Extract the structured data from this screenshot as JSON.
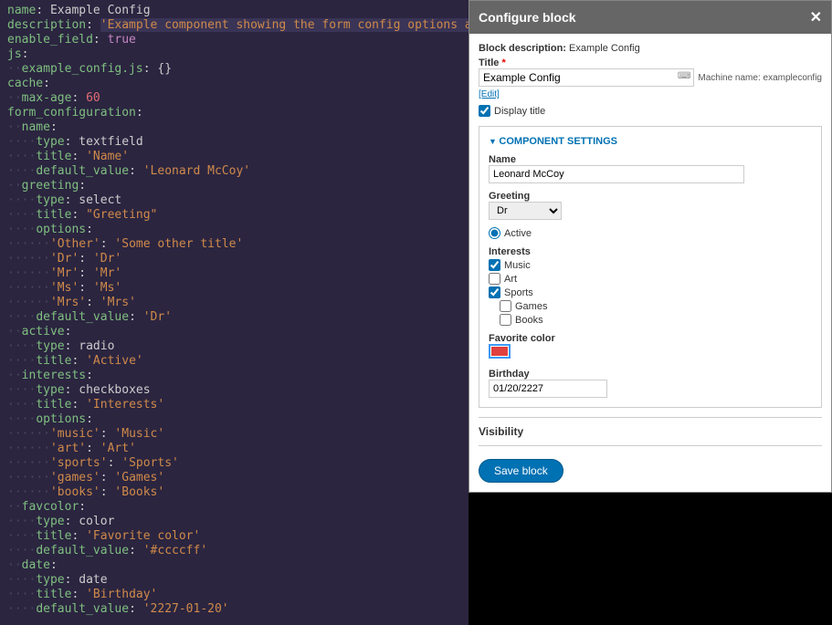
{
  "code": {
    "name": "Example Config",
    "description": "'Example component showing the form config options available'",
    "enable_field": "true",
    "js_key": "js",
    "js_file": "example_config.js",
    "cache_key": "cache",
    "max_age": "60",
    "form_cfg": "form_configuration",
    "name_block": {
      "type": "textfield",
      "title": "'Name'",
      "default": "'Leonard McCoy'"
    },
    "greeting_block": {
      "type": "select",
      "title": "\"Greeting\"",
      "opts": [
        [
          "'Other'",
          "'Some other title'"
        ],
        [
          "'Dr'",
          "'Dr'"
        ],
        [
          "'Mr'",
          "'Mr'"
        ],
        [
          "'Ms'",
          "'Ms'"
        ],
        [
          "'Mrs'",
          "'Mrs'"
        ]
      ],
      "default": "'Dr'"
    },
    "active_block": {
      "type": "radio",
      "title": "'Active'"
    },
    "interests_block": {
      "type": "checkboxes",
      "title": "'Interests'",
      "opts": [
        [
          "'music'",
          "'Music'"
        ],
        [
          "'art'",
          "'Art'"
        ],
        [
          "'sports'",
          "'Sports'"
        ],
        [
          "'games'",
          "'Games'"
        ],
        [
          "'books'",
          "'Books'"
        ]
      ]
    },
    "favcolor_block": {
      "type": "color",
      "title": "'Favorite color'",
      "default": "'#ccccff'"
    },
    "date_block": {
      "type": "date",
      "title": "'Birthday'",
      "default": "'2227-01-20'"
    }
  },
  "dialog": {
    "header": "Configure block",
    "block_desc_label": "Block description:",
    "block_desc_value": "Example Config",
    "title_label": "Title",
    "title_value": "Example Config",
    "machine_name_label": "Machine name:",
    "machine_name_value": "exampleconfig",
    "edit": "[Edit]",
    "display_title": "Display title",
    "component_settings": "COMPONENT SETTINGS",
    "name_label": "Name",
    "name_value": "Leonard McCoy",
    "greeting_label": "Greeting",
    "greeting_value": "Dr",
    "active_label": "Active",
    "interests_label": "Interests",
    "int_music": "Music",
    "int_art": "Art",
    "int_sports": "Sports",
    "int_games": "Games",
    "int_books": "Books",
    "favcolor_label": "Favorite color",
    "favcolor_value": "#e04040",
    "birthday_label": "Birthday",
    "birthday_value": "01/20/2227",
    "visibility": "Visibility",
    "save": "Save block"
  }
}
